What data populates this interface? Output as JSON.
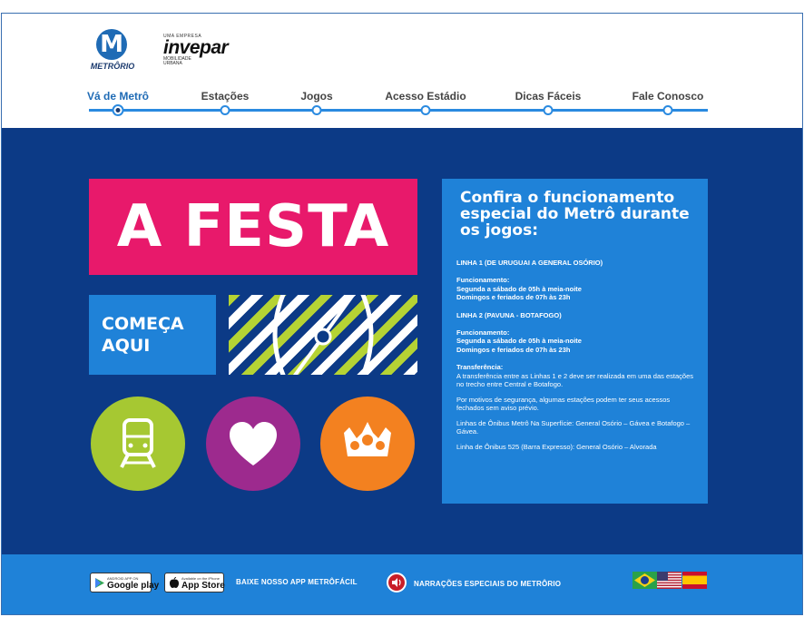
{
  "header": {
    "metro_logo_text": "METRÔRIO",
    "metro_logo_letter": "M",
    "invepar_small": "UMA EMPRESA",
    "invepar_name": "invepar",
    "invepar_sub1": "MOBILIDADE",
    "invepar_sub2": "URBANA"
  },
  "nav": {
    "items": [
      {
        "label": "Vá de Metrô",
        "active": true
      },
      {
        "label": "Estações"
      },
      {
        "label": "Jogos"
      },
      {
        "label": "Acesso Estádio"
      },
      {
        "label": "Dicas Fáceis"
      },
      {
        "label": "Fale Conosco"
      }
    ]
  },
  "hero": {
    "title": "A FESTA",
    "subtitle_line1": "COMEÇA",
    "subtitle_line2": "AQUI"
  },
  "info": {
    "heading": "Confira o funcionamento especial do Metrô durante os jogos:",
    "linha1_title": "LINHA 1 (DE URUGUAI A GENERAL OSÓRIO)",
    "linha1_text_1": "Funcionamento:",
    "linha1_text_2": "Segunda a sábado de 05h à meia-noite",
    "linha1_text_3": "Domingos e feriados de 07h às 23h",
    "linha2_title": "LINHA 2 (PAVUNA - BOTAFOGO)",
    "linha2_text_1": "Funcionamento:",
    "linha2_text_2": "Segunda a sábado de 05h à meia-noite",
    "linha2_text_3": "Domingos e feriados de 07h às 23h",
    "transfer_title": "Transferência:",
    "transfer_text": "A transferência entre as Linhas 1 e 2 deve ser realizada em uma das estações no trecho entre Central e Botafogo.",
    "security_text": "Por motivos de segurança, algumas estações podem ter seus acessos fechados sem aviso prévio.",
    "bus_text": "Linhas de Ônibus Metrô Na Superfície: General Osório – Gávea e Botafogo – Gávea.",
    "bus525_text": "Linha de Ônibus 525 (Barra Expresso): General Osório – Alvorada"
  },
  "footer": {
    "google_small": "ANDROID APP ON",
    "google_name": "Google play",
    "apple_small": "Available on the iPhone",
    "apple_name": "App Store",
    "app_text": "BAIXE NOSSO APP METRÔFÁCIL",
    "narration_text": "NARRAÇÕES ESPECIAIS DO METRÔRIO",
    "flags": [
      "brazil-flag",
      "usa-flag",
      "spain-flag"
    ]
  },
  "colors": {
    "navy": "#0c3a86",
    "blue": "#1f82d8",
    "pink": "#e8196b",
    "green": "#a6c832",
    "purple": "#9d2a8e",
    "orange": "#f38120"
  }
}
